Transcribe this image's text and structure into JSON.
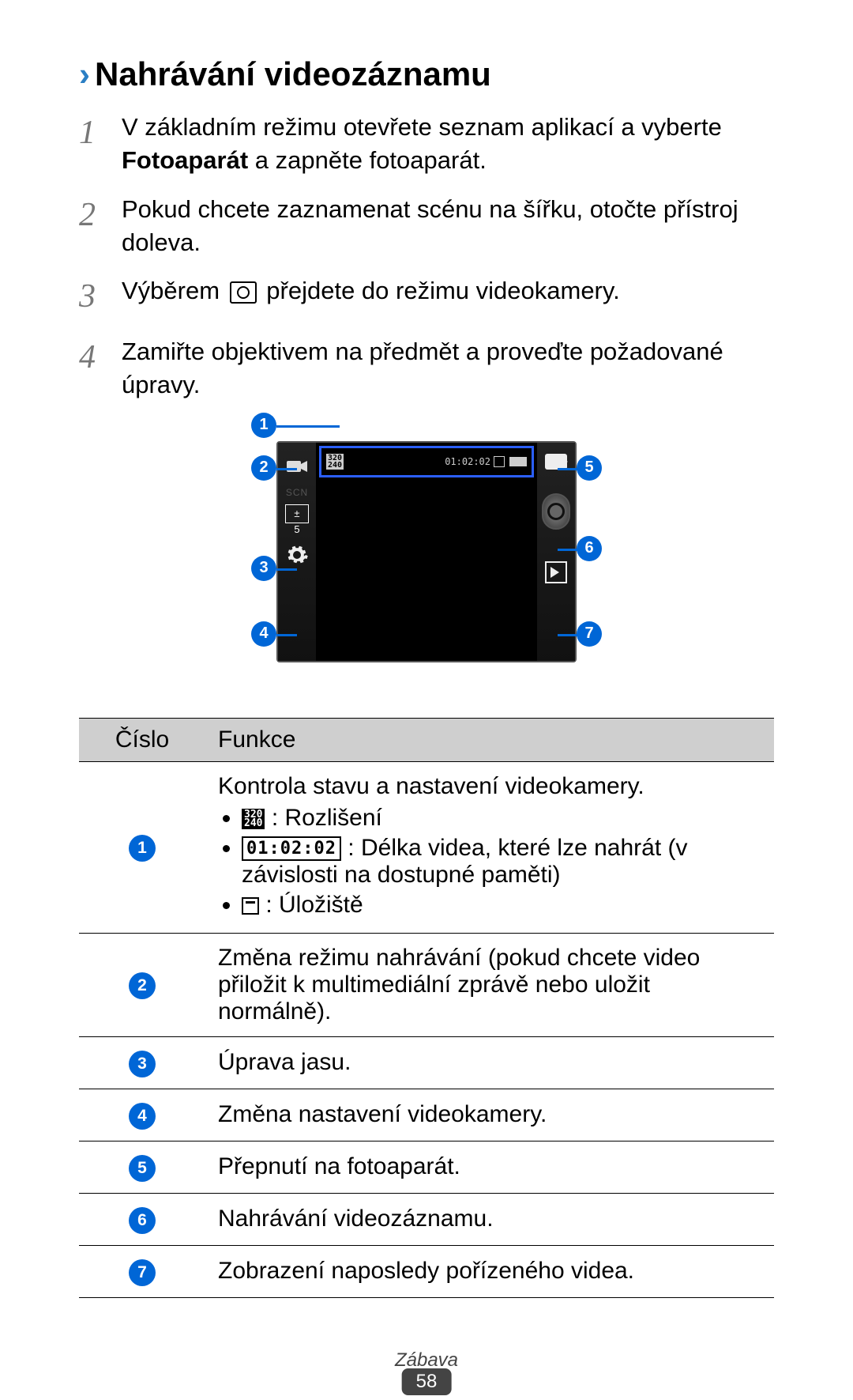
{
  "heading": "Nahrávání videozáznamu",
  "steps": {
    "s1": {
      "num": "1",
      "pre": "V základním režimu otevřete seznam aplikací a vyberte ",
      "bold": "Fotoaparát",
      "post": " a zapněte fotoaparát."
    },
    "s2": {
      "num": "2",
      "text": "Pokud chcete zaznamenat scénu na šířku, otočte přístroj doleva."
    },
    "s3": {
      "num": "3",
      "pre": "Výběrem ",
      "post": " přejdete do režimu videokamery."
    },
    "s4": {
      "num": "4",
      "text": "Zamiřte objektivem na předmět a proveďte požadované úpravy."
    }
  },
  "diagram": {
    "resolution_top": "320",
    "resolution_bottom": "240",
    "time": "01:02:02",
    "scn": "SCN",
    "ev_symbol": "±",
    "ev_value": "5",
    "callouts": {
      "c1": "1",
      "c2": "2",
      "c3": "3",
      "c4": "4",
      "c5": "5",
      "c6": "6",
      "c7": "7"
    }
  },
  "table": {
    "head_num": "Číslo",
    "head_func": "Funkce",
    "rows": [
      {
        "n": "1",
        "title": "Kontrola stavu a nastavení videokamery.",
        "li1_label": " : Rozlišení",
        "li2_label": " : Délka videa, které lze nahrát (v závislosti na dostupné paměti)",
        "li3_label": " : Úložiště",
        "res_top": "320",
        "res_bottom": "240",
        "time": "01:02:02"
      },
      {
        "n": "2",
        "text": "Změna režimu nahrávání (pokud chcete video přiložit k multimediální zprávě nebo uložit normálně)."
      },
      {
        "n": "3",
        "text": "Úprava jasu."
      },
      {
        "n": "4",
        "text": "Změna nastavení videokamery."
      },
      {
        "n": "5",
        "text": "Přepnutí na fotoaparát."
      },
      {
        "n": "6",
        "text": "Nahrávání videozáznamu."
      },
      {
        "n": "7",
        "text": "Zobrazení naposledy pořízeného videa."
      }
    ]
  },
  "footer": {
    "section": "Zábava",
    "page": "58"
  }
}
